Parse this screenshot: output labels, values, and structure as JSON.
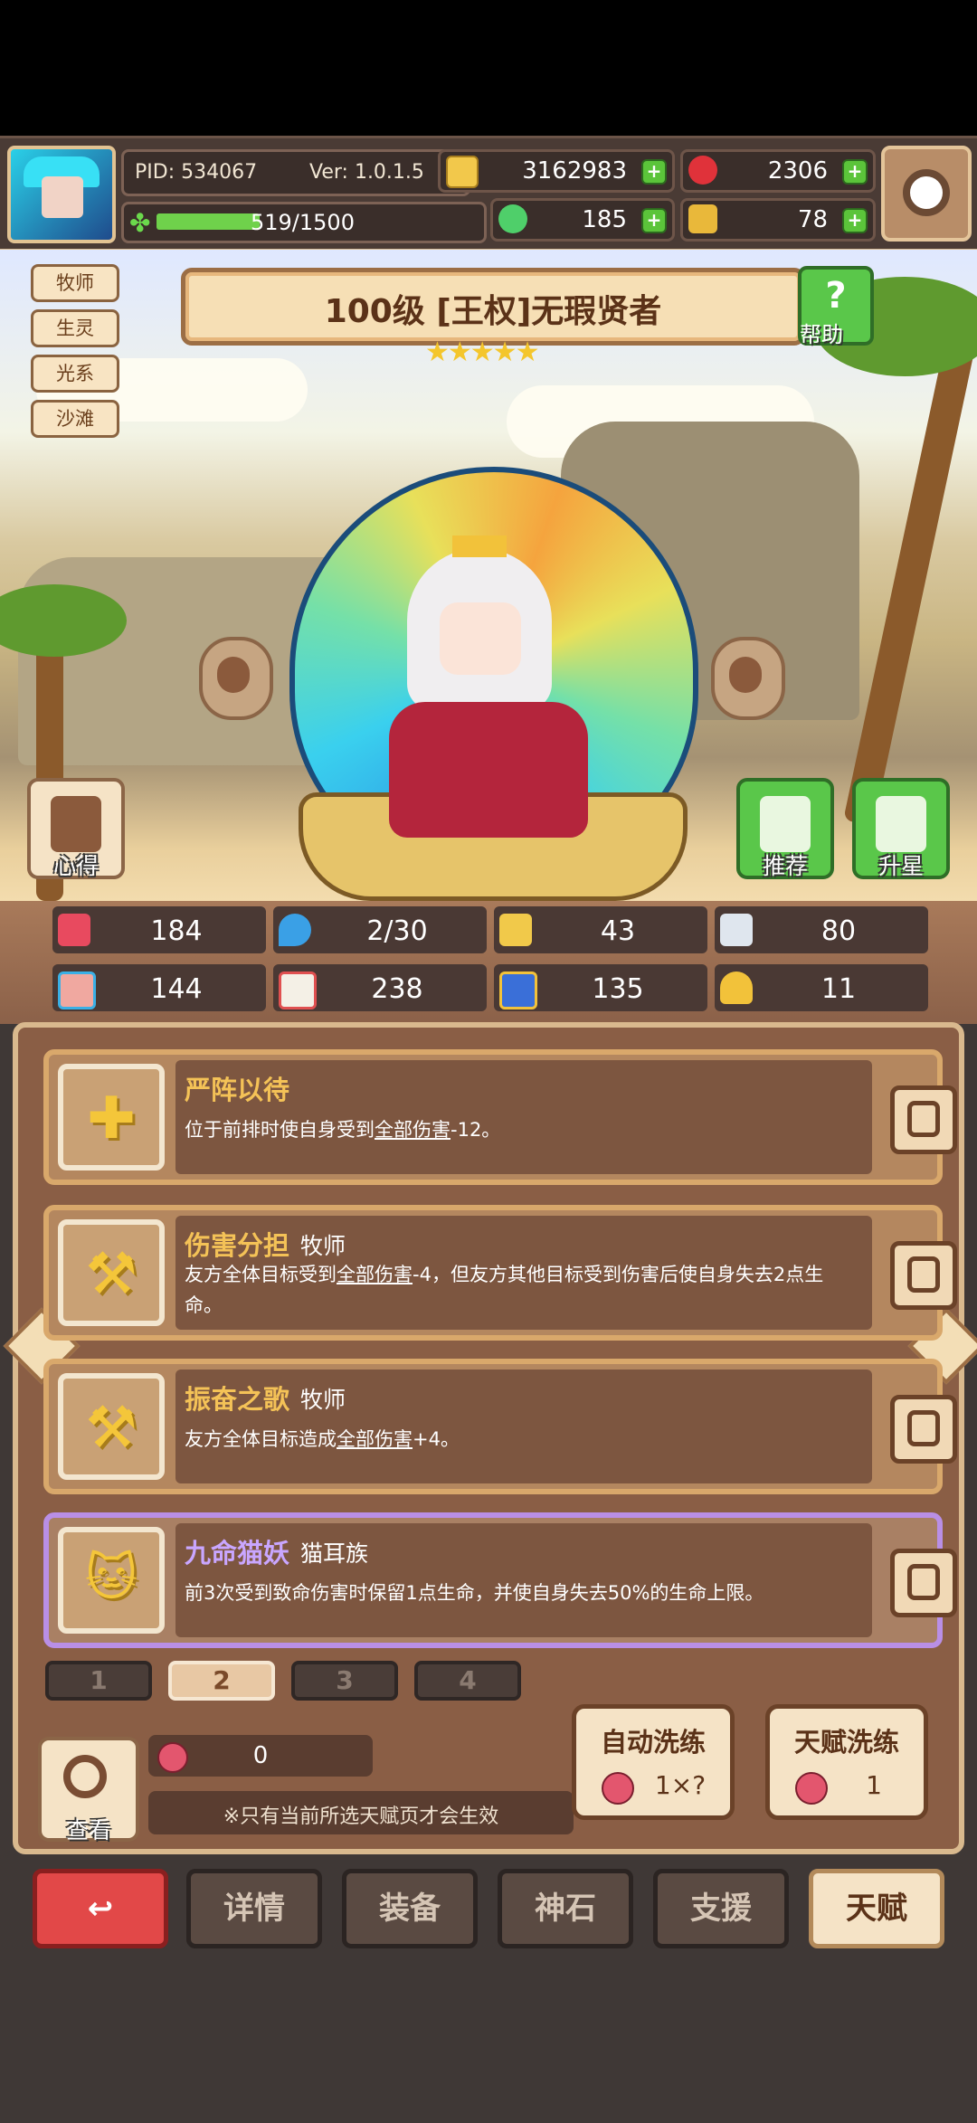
{
  "header": {
    "pid": "PID: 534067",
    "version": "Ver: 1.0.1.5",
    "exp": "519/1500",
    "exp_progress": 0.346,
    "gold": "3162983",
    "gems": "2306",
    "clover": "185",
    "keys": "78",
    "plus": "+"
  },
  "hero": {
    "tags": [
      "牧师",
      "生灵",
      "光系",
      "沙滩"
    ],
    "title": "100级  [王权]无瑕贤者",
    "stars": "★★★★★",
    "star_count": 5,
    "help_label": "帮助",
    "help_glyph": "?",
    "left_button": "心得",
    "recommend_button": "推荐",
    "upstar_button": "升星"
  },
  "stats": [
    {
      "icon": "heart-icon",
      "value": "184",
      "color": "#e84a5f"
    },
    {
      "icon": "water-drop-icon",
      "value": "2/30",
      "color": "#3aa0e6"
    },
    {
      "icon": "shield-icon",
      "value": "43",
      "color": "#f1c94a"
    },
    {
      "icon": "wing-icon",
      "value": "80",
      "color": "#dfe6ee"
    },
    {
      "icon": "fist-icon",
      "value": "144",
      "color": "#f0a8a0"
    },
    {
      "icon": "book-icon",
      "value": "238",
      "color": "#e05050"
    },
    {
      "icon": "boot-icon",
      "value": "135",
      "color": "#3a6fd8"
    },
    {
      "icon": "horseshoe-icon",
      "value": "11",
      "color": "#f2c23a"
    }
  ],
  "talents": [
    {
      "name": "严阵以待",
      "class": "",
      "desc_pre": "位于前排时使自身受到",
      "desc_link": "全部伤害",
      "desc_post": "-12。",
      "glyph": "✚"
    },
    {
      "name": "伤害分担",
      "class": "牧师",
      "desc_pre": "友方全体目标受到",
      "desc_link": "全部伤害",
      "desc_post": "-4，但友方其他目标受到伤害后使自身失去2点生命。",
      "glyph": "⚒"
    },
    {
      "name": "振奋之歌",
      "class": "牧师",
      "desc_pre": "友方全体目标造成",
      "desc_link": "全部伤害",
      "desc_post": "+4。",
      "glyph": "⚒"
    },
    {
      "name": "九命猫妖",
      "class": "猫耳族",
      "desc_pre": "前3次受到致命伤害时保留1点生命，并使自身失去50%的生命上限。",
      "desc_link": "",
      "desc_post": "",
      "glyph": "🐱"
    }
  ],
  "pages": [
    "1",
    "2",
    "3",
    "4"
  ],
  "active_page": "2",
  "bottom": {
    "view_label": "查看",
    "berry_count": "0",
    "note": "※只有当前所选天赋页才会生效",
    "auto_refine_label": "自动洗练",
    "auto_refine_cost": "1×?",
    "talent_refine_label": "天赋洗练",
    "talent_refine_cost": "1"
  },
  "nav": {
    "back": "↩",
    "details": "详情",
    "equipment": "装备",
    "god_stone": "神石",
    "support": "支援",
    "talent": "天赋"
  }
}
